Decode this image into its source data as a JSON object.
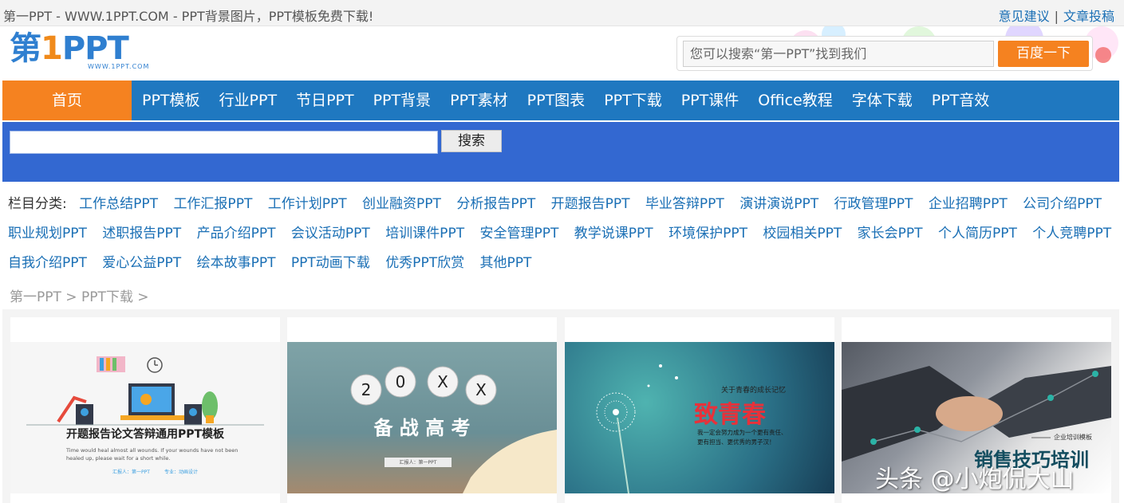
{
  "top": {
    "site_title": "第一PPT - WWW.1PPT.COM - PPT背景图片，PPT模板免费下载!",
    "link_feedback": "意见建议",
    "separator": "|",
    "link_submit": "文章投稿"
  },
  "logo": {
    "part1": "第",
    "part2": "1",
    "part3": "PPT",
    "domain": "WWW.1PPT.COM"
  },
  "header_search": {
    "placeholder": "您可以搜索“第一PPT”找到我们",
    "button": "百度一下"
  },
  "nav": {
    "home": "首页",
    "items": [
      "PPT模板",
      "行业PPT",
      "节日PPT",
      "PPT背景",
      "PPT素材",
      "PPT图表",
      "PPT下载",
      "PPT课件",
      "Office教程",
      "字体下载",
      "PPT音效"
    ]
  },
  "site_search": {
    "button": "搜索"
  },
  "categories": {
    "label": "栏目分类:",
    "rows": [
      [
        "工作总结PPT",
        "工作汇报PPT",
        "工作计划PPT",
        "创业融资PPT",
        "分析报告PPT",
        "开题报告PPT",
        "毕业答辩PPT",
        "演讲演说PPT",
        "行政管理PPT",
        "企业招聘PPT",
        "公司介绍PPT"
      ],
      [
        "职业规划PPT",
        "述职报告PPT",
        "产品介绍PPT",
        "会议活动PPT",
        "培训课件PPT",
        "安全管理PPT",
        "教学说课PPT",
        "环境保护PPT",
        "校园相关PPT",
        "家长会PPT",
        "个人简历PPT",
        "个人竞聘PPT"
      ],
      [
        "自我介绍PPT",
        "爱心公益PPT",
        "绘本故事PPT",
        "PPT动画下载",
        "优秀PPT欣赏",
        "其他PPT"
      ]
    ]
  },
  "breadcrumb": "第一PPT > PPT下载 >",
  "cards": [
    {
      "title": "开题报告论文答辩通用PPT模板",
      "subtitle_1": "Time would heal almost all wounds. If your wounds have not been",
      "subtitle_2": "healed up, please wait for a short while.",
      "reporter": "汇报人：第一PPT",
      "major": "专业：动画设计"
    },
    {
      "balls": [
        "2",
        "0",
        "X",
        "X"
      ],
      "title": "备 战 高 考",
      "reporter": "汇报人：第一PPT"
    },
    {
      "kicker": "关于青春的成长记忆",
      "title": "致青春",
      "line_1": "我一定会努力成为一个更有责任、",
      "line_2": "更有担当、更优秀的男子汉！"
    },
    {
      "kicker": "企业培训模板",
      "title": "销售技巧培训"
    }
  ],
  "watermark": "头条 @小炮侃大山",
  "colors": {
    "nav_blue": "#1f78c0",
    "accent_orange": "#f58220",
    "band_blue": "#3368d1",
    "link_blue": "#1a6fb5"
  }
}
